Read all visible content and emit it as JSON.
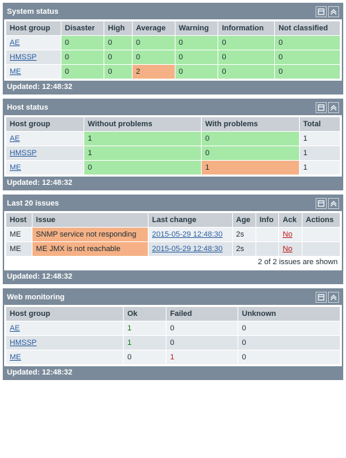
{
  "system_status": {
    "title": "System status",
    "updated": "Updated: 12:48:32",
    "cols": [
      "Host group",
      "Disaster",
      "High",
      "Average",
      "Warning",
      "Information",
      "Not classified"
    ],
    "rows": [
      {
        "group": "AE",
        "vals": [
          "0",
          "0",
          "0",
          "0",
          "0",
          "0"
        ],
        "cls": [
          "g",
          "g",
          "g",
          "g",
          "g",
          "g"
        ]
      },
      {
        "group": "HMSSP",
        "vals": [
          "0",
          "0",
          "0",
          "0",
          "0",
          "0"
        ],
        "cls": [
          "g",
          "g",
          "g",
          "g",
          "g",
          "g"
        ]
      },
      {
        "group": "ME",
        "vals": [
          "0",
          "0",
          "2",
          "0",
          "0",
          "0"
        ],
        "cls": [
          "g",
          "g",
          "o",
          "g",
          "g",
          "g"
        ]
      }
    ]
  },
  "host_status": {
    "title": "Host status",
    "updated": "Updated: 12:48:32",
    "cols": [
      "Host group",
      "Without problems",
      "With problems",
      "Total"
    ],
    "rows": [
      {
        "group": "AE",
        "vals": [
          "1",
          "0",
          "1"
        ],
        "cls": [
          "g",
          "g",
          ""
        ]
      },
      {
        "group": "HMSSP",
        "vals": [
          "1",
          "0",
          "1"
        ],
        "cls": [
          "g",
          "g",
          ""
        ]
      },
      {
        "group": "ME",
        "vals": [
          "0",
          "1",
          "1"
        ],
        "cls": [
          "g",
          "o",
          ""
        ]
      }
    ]
  },
  "last_issues": {
    "title": "Last 20 issues",
    "updated": "Updated: 12:48:32",
    "cols": [
      "Host",
      "Issue",
      "Last change",
      "Age",
      "Info",
      "Ack",
      "Actions"
    ],
    "rows": [
      {
        "host": "ME",
        "issue": "SNMP service not responding",
        "lc": "2015-05-29 12:48:30",
        "age": "2s",
        "info": "",
        "ack": "No",
        "actions": ""
      },
      {
        "host": "ME",
        "issue": "ME JMX is not reachable",
        "lc": "2015-05-29 12:48:30",
        "age": "2s",
        "info": "",
        "ack": "No",
        "actions": ""
      }
    ],
    "footer_note": "2 of 2 issues are shown"
  },
  "web_monitoring": {
    "title": "Web monitoring",
    "updated": "Updated: 12:48:32",
    "cols": [
      "Host group",
      "Ok",
      "Failed",
      "Unknown"
    ],
    "rows": [
      {
        "group": "AE",
        "vals": [
          "1",
          "0",
          "0"
        ],
        "ok": "1",
        "failed": "0"
      },
      {
        "group": "HMSSP",
        "vals": [
          "1",
          "0",
          "0"
        ],
        "ok": "1",
        "failed": "0"
      },
      {
        "group": "ME",
        "vals": [
          "0",
          "1",
          "0"
        ],
        "ok": "0",
        "failed": "1"
      }
    ]
  }
}
